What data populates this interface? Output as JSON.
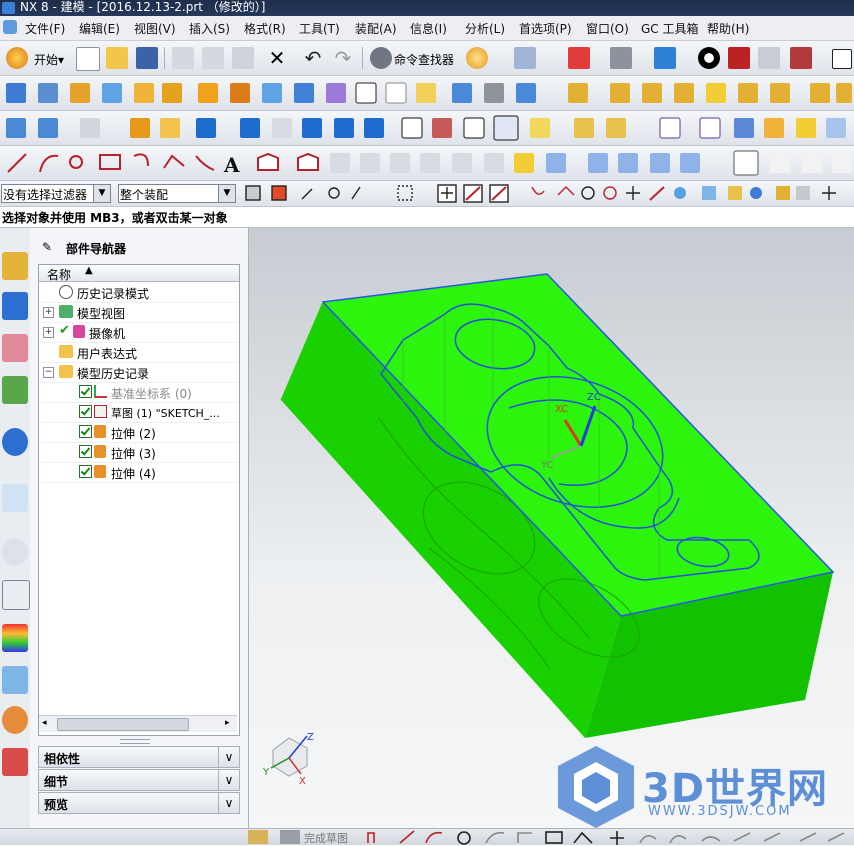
{
  "window": {
    "title": "NX 8 - 建模 - [2016.12.13-2.prt （修改的）]"
  },
  "menu": [
    "文件(F)",
    "编辑(E)",
    "视图(V)",
    "插入(S)",
    "格式(R)",
    "工具(T)",
    "装配(A)",
    "信息(I)",
    "分析(L)",
    "首选项(P)",
    "窗口(O)",
    "GC 工具箱",
    "帮助(H)"
  ],
  "toolbar": {
    "start_label": "开始▾",
    "command_finder_label": "命令查找器"
  },
  "selection": {
    "filter_value": "没有选择过滤器",
    "scope_value": "整个装配"
  },
  "status": {
    "prompt": "选择对象并使用 MB3，或者双击某一对象"
  },
  "navigator": {
    "title": "部件导航器",
    "column_header": "名称",
    "items": [
      {
        "label": "历史记录模式"
      },
      {
        "label": "模型视图"
      },
      {
        "label": "摄像机"
      },
      {
        "label": "用户表达式"
      },
      {
        "label": "模型历史记录"
      },
      {
        "label": "基准坐标系 (0)"
      },
      {
        "label": "草图 (1) \"SKETCH_..."
      },
      {
        "label": "拉伸 (2)"
      },
      {
        "label": "拉伸 (3)"
      },
      {
        "label": "拉伸 (4)"
      }
    ],
    "sections": [
      "相依性",
      "细节",
      "预览"
    ]
  },
  "viewport": {
    "axis_labels": {
      "xc": "XC",
      "yc": "YC",
      "zc": "ZC"
    },
    "triad_labels": {
      "x": "X",
      "y": "Y",
      "z": "Z"
    },
    "model_color": "#22ee00"
  },
  "bottom": {
    "finish_sketch_label": "完成草图"
  },
  "watermark": {
    "brand": "3D世界网",
    "url": "WWW.3DSJW.COM"
  }
}
